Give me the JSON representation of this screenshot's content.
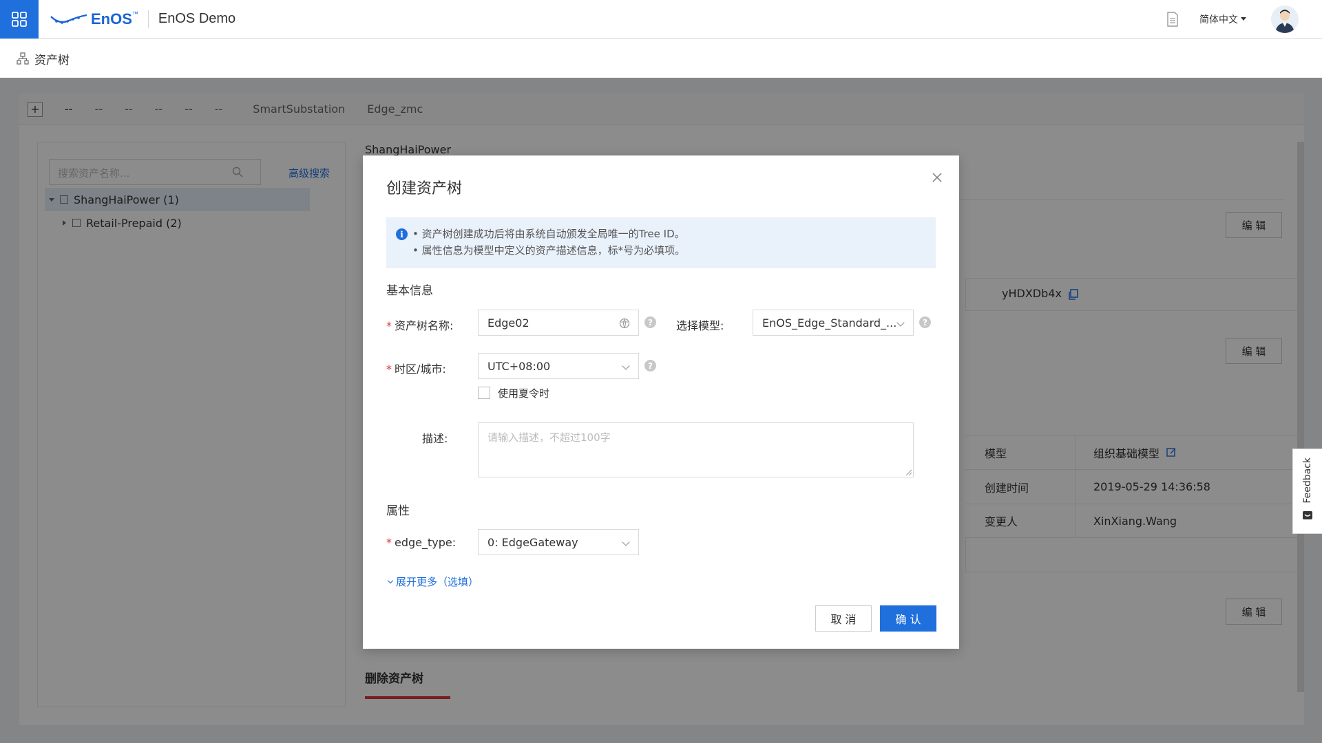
{
  "header": {
    "logo_text": "EnOS",
    "logo_tm": "™",
    "app_title": "EnOS Demo",
    "language": "简体中文"
  },
  "breadcrumb": {
    "title": "资产树"
  },
  "tabs": [
    "--",
    "--",
    "--",
    "--",
    "--",
    "--",
    "SmartSubstation",
    "Edge_zmc"
  ],
  "add_tab_label": "+",
  "left_panel": {
    "search_placeholder": "搜索资产名称...",
    "advanced_search": "高级搜索",
    "tree": [
      {
        "label": "ShangHaiPower (1)"
      },
      {
        "label": "Retail-Prepaid (2)"
      }
    ]
  },
  "right_panel": {
    "title": "ShangHaiPower",
    "edit_label": "编 辑",
    "tree_id_partial": "yHDXDb4x",
    "details": [
      {
        "key": "模型",
        "value": "组织基础模型"
      },
      {
        "key": "创建时间",
        "value": "2019-05-29 14:36:58"
      },
      {
        "key": "变更人",
        "value": "XinXiang.Wang"
      }
    ],
    "delete_title": "删除资产树"
  },
  "feedback_label": "Feedback",
  "modal": {
    "title": "创建资产树",
    "info_lines": [
      "资产树创建成功后将由系统自动颁发全局唯一的Tree ID。",
      "属性信息为模型中定义的资产描述信息，标*号为必填项。"
    ],
    "basic_section": "基本信息",
    "name_label": "资产树名称:",
    "name_value": "Edge02",
    "model_label": "选择模型:",
    "model_value": "EnOS_Edge_Standard_...",
    "timezone_label": "时区/城市:",
    "timezone_value": "UTC+08:00",
    "dst_label": "使用夏令时",
    "dst_checked": false,
    "desc_label": "描述:",
    "desc_placeholder": "请输入描述，不超过100字",
    "attr_section": "属性",
    "edge_type_label": "edge_type:",
    "edge_type_value": "0: EdgeGateway",
    "expand_more": "展开更多（选填）",
    "cancel_label": "取 消",
    "ok_label": "确 认"
  },
  "colors": {
    "primary": "#1f6fdc",
    "required": "#e0393e",
    "danger_bar": "#d93a3a",
    "info_bg": "#e9f1fb"
  }
}
